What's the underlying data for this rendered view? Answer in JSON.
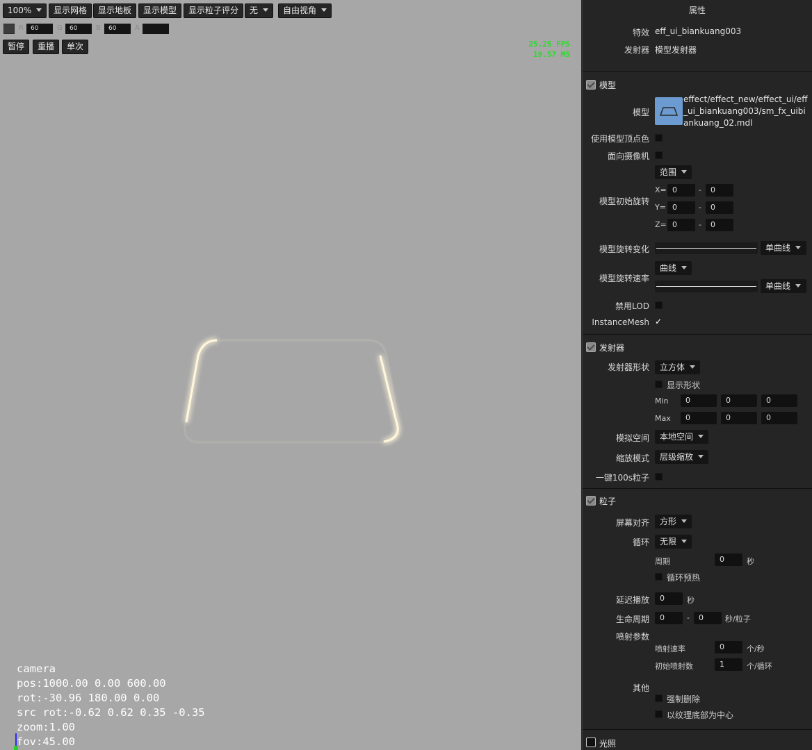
{
  "toolbar": {
    "zoom": "100%",
    "show_grid": "显示网格",
    "show_floor": "显示地板",
    "show_model": "显示模型",
    "show_particle_score": "显示粒子评分",
    "none_select": "无",
    "free_view": "自由视角"
  },
  "color_row": {
    "r_label": "R",
    "r": "60",
    "g_label": "G",
    "g": "60",
    "b_label": "B",
    "b": "60",
    "a_label": "A",
    "a": ""
  },
  "playback": {
    "pause": "暂停",
    "replay": "重播",
    "single": "单次"
  },
  "fps": {
    "line1": "25.25 FPS",
    "line2": "19.57 MS"
  },
  "camera": {
    "title": "camera",
    "pos": "pos:1000.00 0.00 600.00",
    "rot": "rot:-30.96 180.00 0.00",
    "src_rot": "src rot:-0.62 0.62 0.35 -0.35",
    "zoom": "zoom:1.00",
    "fov": "fov:45.00"
  },
  "panel": {
    "title": "属性",
    "effect_label": "特效",
    "effect_value": "eff_ui_biankuang003",
    "emitter_label": "发射器",
    "emitter_value": "模型发射器",
    "model_section": {
      "title": "模型",
      "model_label": "模型",
      "model_path": "effect/effect_new/effect_ui/eff_ui_biankuang003/sm_fx_uibiankuang_02.mdl",
      "use_vertex_color": "使用模型顶点色",
      "face_camera": "面向摄像机",
      "range_select": "范围",
      "init_rotation": "模型初始旋转",
      "x_label": "X=",
      "x_min": "0",
      "x_max": "0",
      "y_label": "Y=",
      "y_min": "0",
      "y_max": "0",
      "z_label": "Z=",
      "z_min": "0",
      "z_max": "0",
      "dash": "-",
      "rot_change": "模型旋转变化",
      "single_curve": "单曲线",
      "rot_speed": "模型旋转速率",
      "curve_select": "曲线",
      "disable_lod": "禁用LOD",
      "instance_mesh": "InstanceMesh",
      "check_mark": "✓"
    },
    "emitter_section": {
      "title": "发射器",
      "shape_label": "发射器形状",
      "shape_value": "立方体",
      "show_shape": "显示形状",
      "min_label": "Min",
      "min": [
        "0",
        "0",
        "0"
      ],
      "max_label": "Max",
      "max": [
        "0",
        "0",
        "0"
      ],
      "sim_space_label": "模拟空间",
      "sim_space_value": "本地空间",
      "scale_mode_label": "缩放模式",
      "scale_mode_value": "层级缩放",
      "one_key_label": "一键100s粒子"
    },
    "particle_section": {
      "title": "粒子",
      "screen_align_label": "屏幕对齐",
      "screen_align_value": "方形",
      "loop_label": "循环",
      "loop_value": "无限",
      "period_label": "周期",
      "period_value": "0",
      "period_unit": "秒",
      "loop_preheat": "循环预热",
      "delay_label": "延迟播放",
      "delay_value": "0",
      "delay_unit": "秒",
      "life_label": "生命周期",
      "life_min": "0",
      "life_max": "0",
      "life_unit": "秒/粒子",
      "emit_params": "喷射参数",
      "emit_rate_label": "喷射速率",
      "emit_rate_value": "0",
      "emit_rate_unit": "个/秒",
      "init_emit_label": "初始喷射数",
      "init_emit_value": "1",
      "init_emit_unit": "个/循环",
      "other_label": "其他",
      "force_delete": "强制删除",
      "texture_center": "以纹理底部为中心"
    },
    "light_section": {
      "title": "光照"
    }
  }
}
